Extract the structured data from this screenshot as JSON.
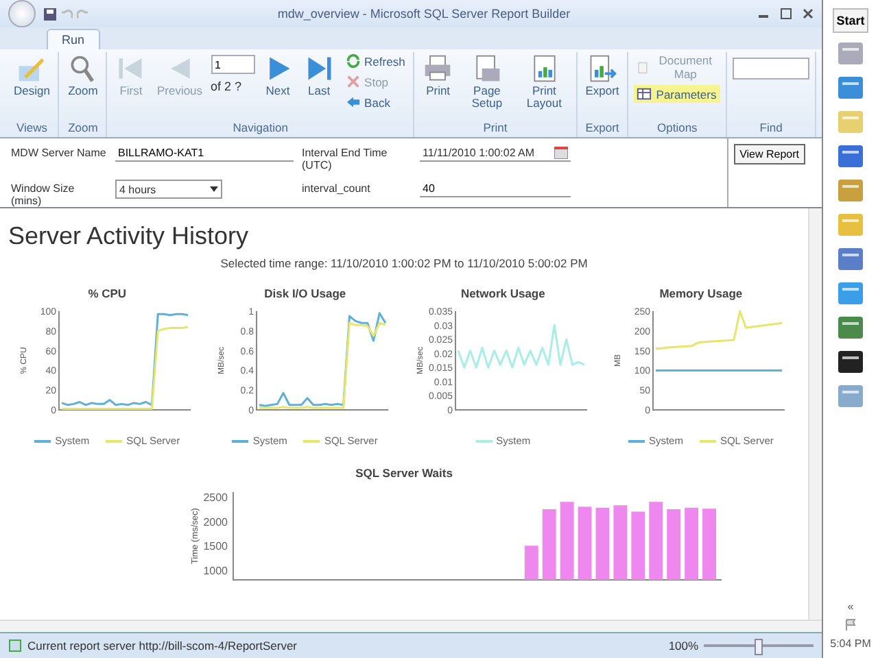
{
  "window": {
    "title": "mdw_overview - Microsoft SQL Server Report Builder"
  },
  "tabs": [
    {
      "label": "Run",
      "selected": true
    }
  ],
  "ribbon": {
    "groups": [
      {
        "label": "Views",
        "items": [
          {
            "kind": "large",
            "label": "Design",
            "disabled": false
          }
        ]
      },
      {
        "label": "Zoom",
        "items": [
          {
            "kind": "large",
            "label": "Zoom",
            "disabled": false
          }
        ]
      },
      {
        "label": "Navigation",
        "items": [
          {
            "kind": "large",
            "label": "First",
            "disabled": true
          },
          {
            "kind": "large",
            "label": "Previous",
            "disabled": true
          },
          {
            "kind": "page",
            "value": "1",
            "of": "of 2 ?"
          },
          {
            "kind": "large",
            "label": "Next",
            "disabled": false
          },
          {
            "kind": "large",
            "label": "Last",
            "disabled": false
          },
          {
            "kind": "small",
            "label": "Refresh",
            "disabled": false
          },
          {
            "kind": "small",
            "label": "Stop",
            "disabled": true
          },
          {
            "kind": "small",
            "label": "Back",
            "disabled": false
          }
        ]
      },
      {
        "label": "Print",
        "items": [
          {
            "kind": "large",
            "label": "Print",
            "disabled": false
          },
          {
            "kind": "large",
            "label": "Page Setup",
            "disabled": false
          },
          {
            "kind": "large",
            "label": "Print Layout",
            "disabled": false
          }
        ]
      },
      {
        "label": "Export",
        "items": [
          {
            "kind": "large",
            "label": "Export",
            "disabled": false
          }
        ]
      },
      {
        "label": "Options",
        "items": [
          {
            "kind": "small",
            "label": "Document Map",
            "disabled": true,
            "on": false
          },
          {
            "kind": "small",
            "label": "Parameters",
            "disabled": false,
            "on": true
          }
        ]
      },
      {
        "label": "Find",
        "items": [
          {
            "kind": "find"
          }
        ]
      }
    ]
  },
  "parameters": {
    "fields": [
      {
        "label": "MDW Server Name",
        "value": "BILLRAMO-KAT1",
        "kind": "text"
      },
      {
        "label": "Interval End Time (UTC)",
        "value": "11/11/2010 1:00:02 AM",
        "kind": "date"
      },
      {
        "label": "Window Size (mins)",
        "value": "4 hours",
        "kind": "dropdown"
      },
      {
        "label": "interval_count",
        "value": "40",
        "kind": "text"
      }
    ],
    "button": "View Report"
  },
  "report": {
    "title": "Server Activity History",
    "subtitle": "Selected time range: 11/10/2010 1:00:02 PM to 11/10/2010 5:00:02 PM",
    "charts": [
      {
        "chart_data": {
          "type": "line",
          "title": "% CPU",
          "ylabel": "% CPU",
          "ylim": [
            0,
            100
          ],
          "yticks": [
            0,
            20,
            40,
            60,
            80,
            100
          ],
          "series": [
            {
              "name": "System",
              "color": "#5fb0d8",
              "values": [
                7,
                5,
                6,
                8,
                5,
                7,
                6,
                6,
                10,
                5,
                6,
                5,
                7,
                6,
                8,
                5,
                97,
                97,
                96,
                97,
                97,
                96
              ]
            },
            {
              "name": "SQL Server",
              "color": "#e6e66a",
              "values": [
                1,
                1,
                1,
                1,
                1,
                1,
                1,
                1,
                1,
                1,
                1,
                1,
                1,
                1,
                1,
                1,
                80,
                82,
                83,
                83,
                83,
                84
              ]
            }
          ]
        }
      },
      {
        "chart_data": {
          "type": "line",
          "title": "Disk I/O Usage",
          "ylabel": "MB/sec",
          "ylim": [
            0,
            1
          ],
          "yticks": [
            0,
            0.2,
            0.4,
            0.6,
            0.8,
            1
          ],
          "series": [
            {
              "name": "System",
              "color": "#5fb0d8",
              "values": [
                0.05,
                0.04,
                0.05,
                0.06,
                0.17,
                0.05,
                0.05,
                0.05,
                0.12,
                0.05,
                0.05,
                0.06,
                0.05,
                0.06,
                0.05,
                0.95,
                0.9,
                0.88,
                0.88,
                0.7,
                0.98,
                0.88
              ]
            },
            {
              "name": "SQL Server",
              "color": "#e6e66a",
              "values": [
                0.02,
                0.02,
                0.02,
                0.02,
                0.03,
                0.02,
                0.02,
                0.02,
                0.03,
                0.02,
                0.02,
                0.02,
                0.02,
                0.02,
                0.02,
                0.88,
                0.86,
                0.86,
                0.85,
                0.75,
                0.88,
                0.86
              ]
            }
          ]
        }
      },
      {
        "chart_data": {
          "type": "line",
          "title": "Network Usage",
          "ylabel": "MB/sec",
          "ylim": [
            0,
            0.035
          ],
          "yticks": [
            0,
            0.005,
            0.01,
            0.015,
            0.02,
            0.025,
            0.03,
            0.035
          ],
          "series": [
            {
              "name": "System",
              "color": "#a8eee6",
              "values": [
                0.021,
                0.015,
                0.021,
                0.015,
                0.022,
                0.015,
                0.021,
                0.016,
                0.021,
                0.015,
                0.022,
                0.016,
                0.021,
                0.016,
                0.022,
                0.016,
                0.03,
                0.016,
                0.025,
                0.016,
                0.017,
                0.016
              ]
            }
          ]
        }
      },
      {
        "chart_data": {
          "type": "line",
          "title": "Memory Usage",
          "ylabel": "MB",
          "ylim": [
            0,
            250
          ],
          "yticks": [
            0,
            50,
            100,
            150,
            200,
            250
          ],
          "series": [
            {
              "name": "System",
              "color": "#5fb0d8",
              "values": [
                100,
                100,
                100,
                100,
                100,
                100,
                100,
                100,
                100,
                100,
                100,
                100,
                100,
                100,
                100,
                100,
                100,
                100,
                100,
                100,
                100,
                100
              ]
            },
            {
              "name": "SQL Server",
              "color": "#e6e66a",
              "values": [
                155,
                156,
                158,
                159,
                160,
                161,
                162,
                170,
                172,
                173,
                174,
                175,
                176,
                177,
                250,
                208,
                210,
                212,
                214,
                216,
                218,
                220
              ]
            }
          ]
        }
      },
      {
        "chart_data": {
          "type": "bar",
          "title": "SQL Server Waits",
          "categories": [
            null,
            null,
            null,
            null,
            null,
            null,
            null,
            null,
            null,
            null,
            null,
            null,
            null,
            null,
            null,
            null,
            null,
            null,
            null,
            null,
            null,
            null,
            null,
            null,
            null,
            null,
            null
          ],
          "ylabel": "Time (ms/sec)",
          "ylim": [
            800,
            2600
          ],
          "yticks": [
            1000,
            1500,
            2000,
            2500
          ],
          "series": [
            {
              "color": "#ee88ee",
              "values": [
                null,
                null,
                null,
                null,
                null,
                null,
                null,
                null,
                null,
                null,
                null,
                null,
                null,
                null,
                null,
                null,
                1500,
                2250,
                2400,
                2300,
                2280,
                2330,
                2200,
                2400,
                2250,
                2280,
                2260
              ]
            }
          ]
        }
      }
    ]
  },
  "status_bar": {
    "text": "Current report server http://bill-scom-4/ReportServer",
    "zoom": "100%",
    "level": 0.5
  },
  "taskbar": {
    "start": "Start",
    "clock": "5:04 PM",
    "tray": "«"
  }
}
